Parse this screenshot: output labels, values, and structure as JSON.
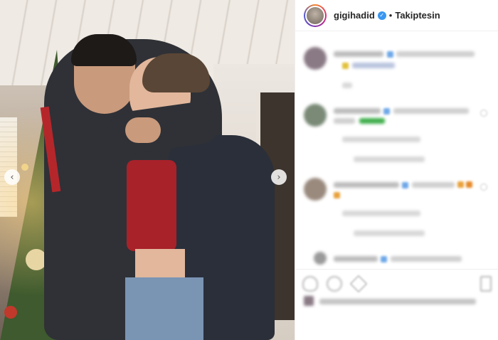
{
  "post": {
    "username": "gigihadid",
    "verified_mark": "✓",
    "separator": "•",
    "follow_label": "Takiptesin"
  },
  "icons": {
    "prev": "chevron-left-icon",
    "next": "chevron-right-icon",
    "verified": "verified-badge-icon"
  },
  "nav": {
    "prev_glyph": "‹",
    "next_glyph": "›"
  },
  "colors": {
    "verified": "#3897f0",
    "follow_text": "#262626",
    "coat_stripe": "#b5262b"
  }
}
